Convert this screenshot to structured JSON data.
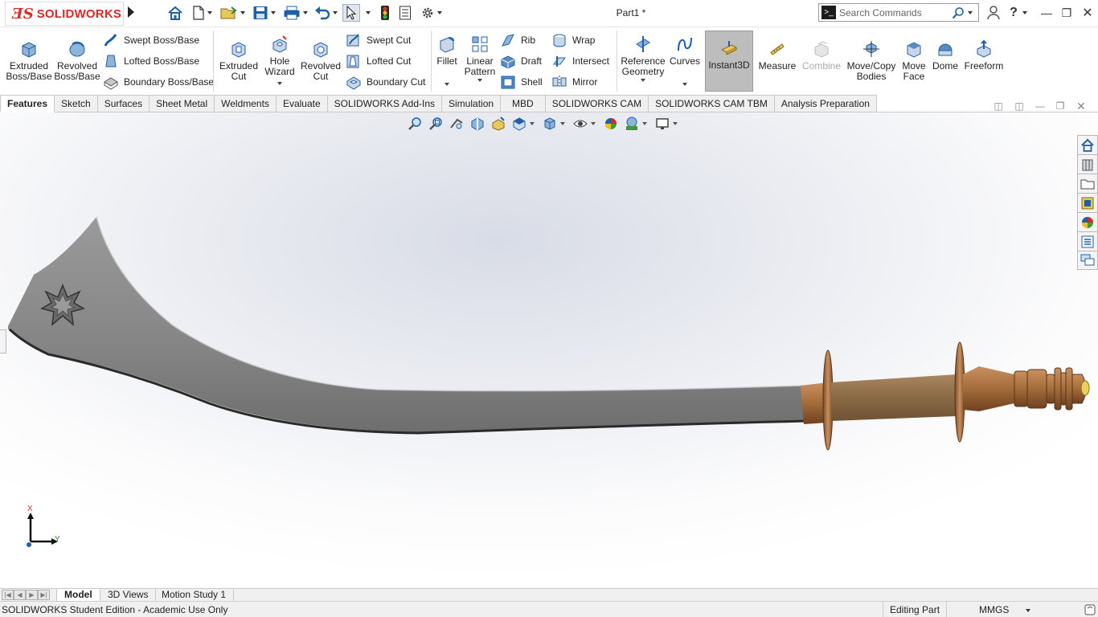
{
  "titlebar": {
    "brand_prefix": "SOLID",
    "brand_suffix": "WORKS",
    "doc_title": "Part1 *",
    "search_placeholder": "Search Commands",
    "icons": [
      "home-icon",
      "new-document-icon",
      "open-icon",
      "save-icon",
      "print-icon",
      "undo-icon",
      "select-icon",
      "rebuild-icon",
      "file-properties-icon",
      "options-icon",
      "user-icon",
      "help-icon"
    ]
  },
  "ribbon": {
    "extruded_boss": "Extruded\nBoss/Base",
    "revolved_boss": "Revolved\nBoss/Base",
    "swept_boss": "Swept Boss/Base",
    "lofted_boss": "Lofted Boss/Base",
    "boundary_boss": "Boundary Boss/Base",
    "extruded_cut": "Extruded\nCut",
    "hole_wizard": "Hole\nWizard",
    "revolved_cut": "Revolved\nCut",
    "swept_cut": "Swept Cut",
    "lofted_cut": "Lofted Cut",
    "boundary_cut": "Boundary Cut",
    "fillet": "Fillet",
    "linear_pattern": "Linear\nPattern",
    "rib": "Rib",
    "draft": "Draft",
    "shell": "Shell",
    "wrap": "Wrap",
    "intersect": "Intersect",
    "mirror": "Mirror",
    "reference_geometry": "Reference\nGeometry",
    "curves": "Curves",
    "instant3d": "Instant3D",
    "measure": "Measure",
    "combine": "Combine",
    "move_copy": "Move/Copy\nBodies",
    "move_face": "Move\nFace",
    "dome": "Dome",
    "freeform": "Freeform"
  },
  "tabs": [
    "Features",
    "Sketch",
    "Surfaces",
    "Sheet Metal",
    "Weldments",
    "Evaluate",
    "SOLIDWORKS Add-Ins",
    "Simulation",
    "MBD",
    "SOLIDWORKS CAM",
    "SOLIDWORKS CAM TBM",
    "Analysis Preparation"
  ],
  "active_tab": "Features",
  "graphics": {
    "triad_x": "X",
    "triad_y": "Y",
    "colors": {
      "blade": "#8c8c8c",
      "bronze": "#a8703d",
      "grip": "#8a6a46",
      "brand_red": "#d62a2a",
      "accent_blue": "#1f5fa8"
    }
  },
  "bottom_tabs": [
    "Model",
    "3D Views",
    "Motion Study 1"
  ],
  "status": {
    "left": "SOLIDWORKS Student Edition - Academic Use Only",
    "editing": "Editing Part",
    "units": "MMGS"
  }
}
